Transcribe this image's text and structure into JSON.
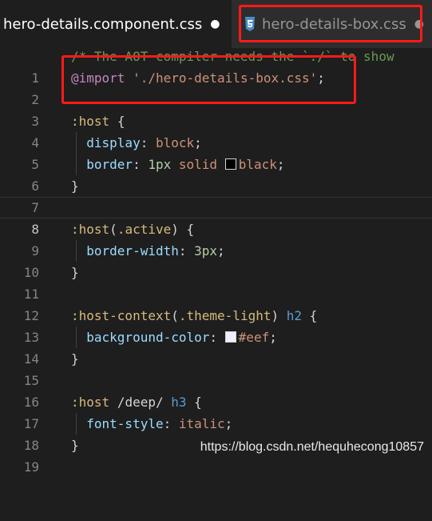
{
  "tabs": [
    {
      "label": "hero-details.component.css",
      "dirty_marker": "●",
      "active": true
    },
    {
      "label": "hero-details-box.css",
      "dirty_marker": "●",
      "active": false,
      "icon": "css3-icon"
    }
  ],
  "colors": {
    "background": "#1e1e1e",
    "highlight_box": "#ff1a1a",
    "swatch_black": "#000000",
    "swatch_eef": "#eeeeff"
  },
  "editor": {
    "line_numbers": [
      "1",
      "2",
      "3",
      "4",
      "5",
      "6",
      "7",
      "8",
      "9",
      "10",
      "11",
      "12",
      "13",
      "14",
      "15",
      "16",
      "17",
      "18",
      "19"
    ],
    "current_line": "8",
    "lines": {
      "l1": {
        "comment": "/* The AOT compiler needs the `./` to show"
      },
      "l2": {
        "at": "@import",
        "str": "'./hero-details-box.css'",
        "punc": ";"
      },
      "l4": {
        "sel": ":host",
        "open": "{"
      },
      "l5": {
        "prop": "display",
        "colon": ":",
        "val": "block",
        "semi": ";"
      },
      "l6": {
        "prop": "border",
        "colon": ":",
        "num": "1px",
        "val": "solid",
        "color": "black",
        "semi": ";"
      },
      "l7": {
        "close": "}"
      },
      "l9": {
        "sel": ":host",
        "paren_open": "(",
        "cls": ".active",
        "paren_close": ")",
        "open": "{"
      },
      "l10": {
        "prop": "border-width",
        "colon": ":",
        "num": "3px",
        "semi": ";"
      },
      "l11": {
        "close": "}"
      },
      "l13": {
        "sel": ":host-context",
        "paren_open": "(",
        "cls": ".theme-light",
        "paren_close": ")",
        "tag": "h2",
        "open": "{"
      },
      "l14": {
        "prop": "background-color",
        "colon": ":",
        "color": "#eef",
        "semi": ";"
      },
      "l15": {
        "close": "}"
      },
      "l17": {
        "sel": ":host",
        "deep": "/deep/",
        "tag": "h3",
        "open": "{"
      },
      "l18": {
        "prop": "font-style",
        "colon": ":",
        "val": "italic",
        "semi": ";"
      },
      "l19": {
        "close": "}"
      }
    }
  },
  "watermark": "https://blog.csdn.net/hequhecong10857"
}
